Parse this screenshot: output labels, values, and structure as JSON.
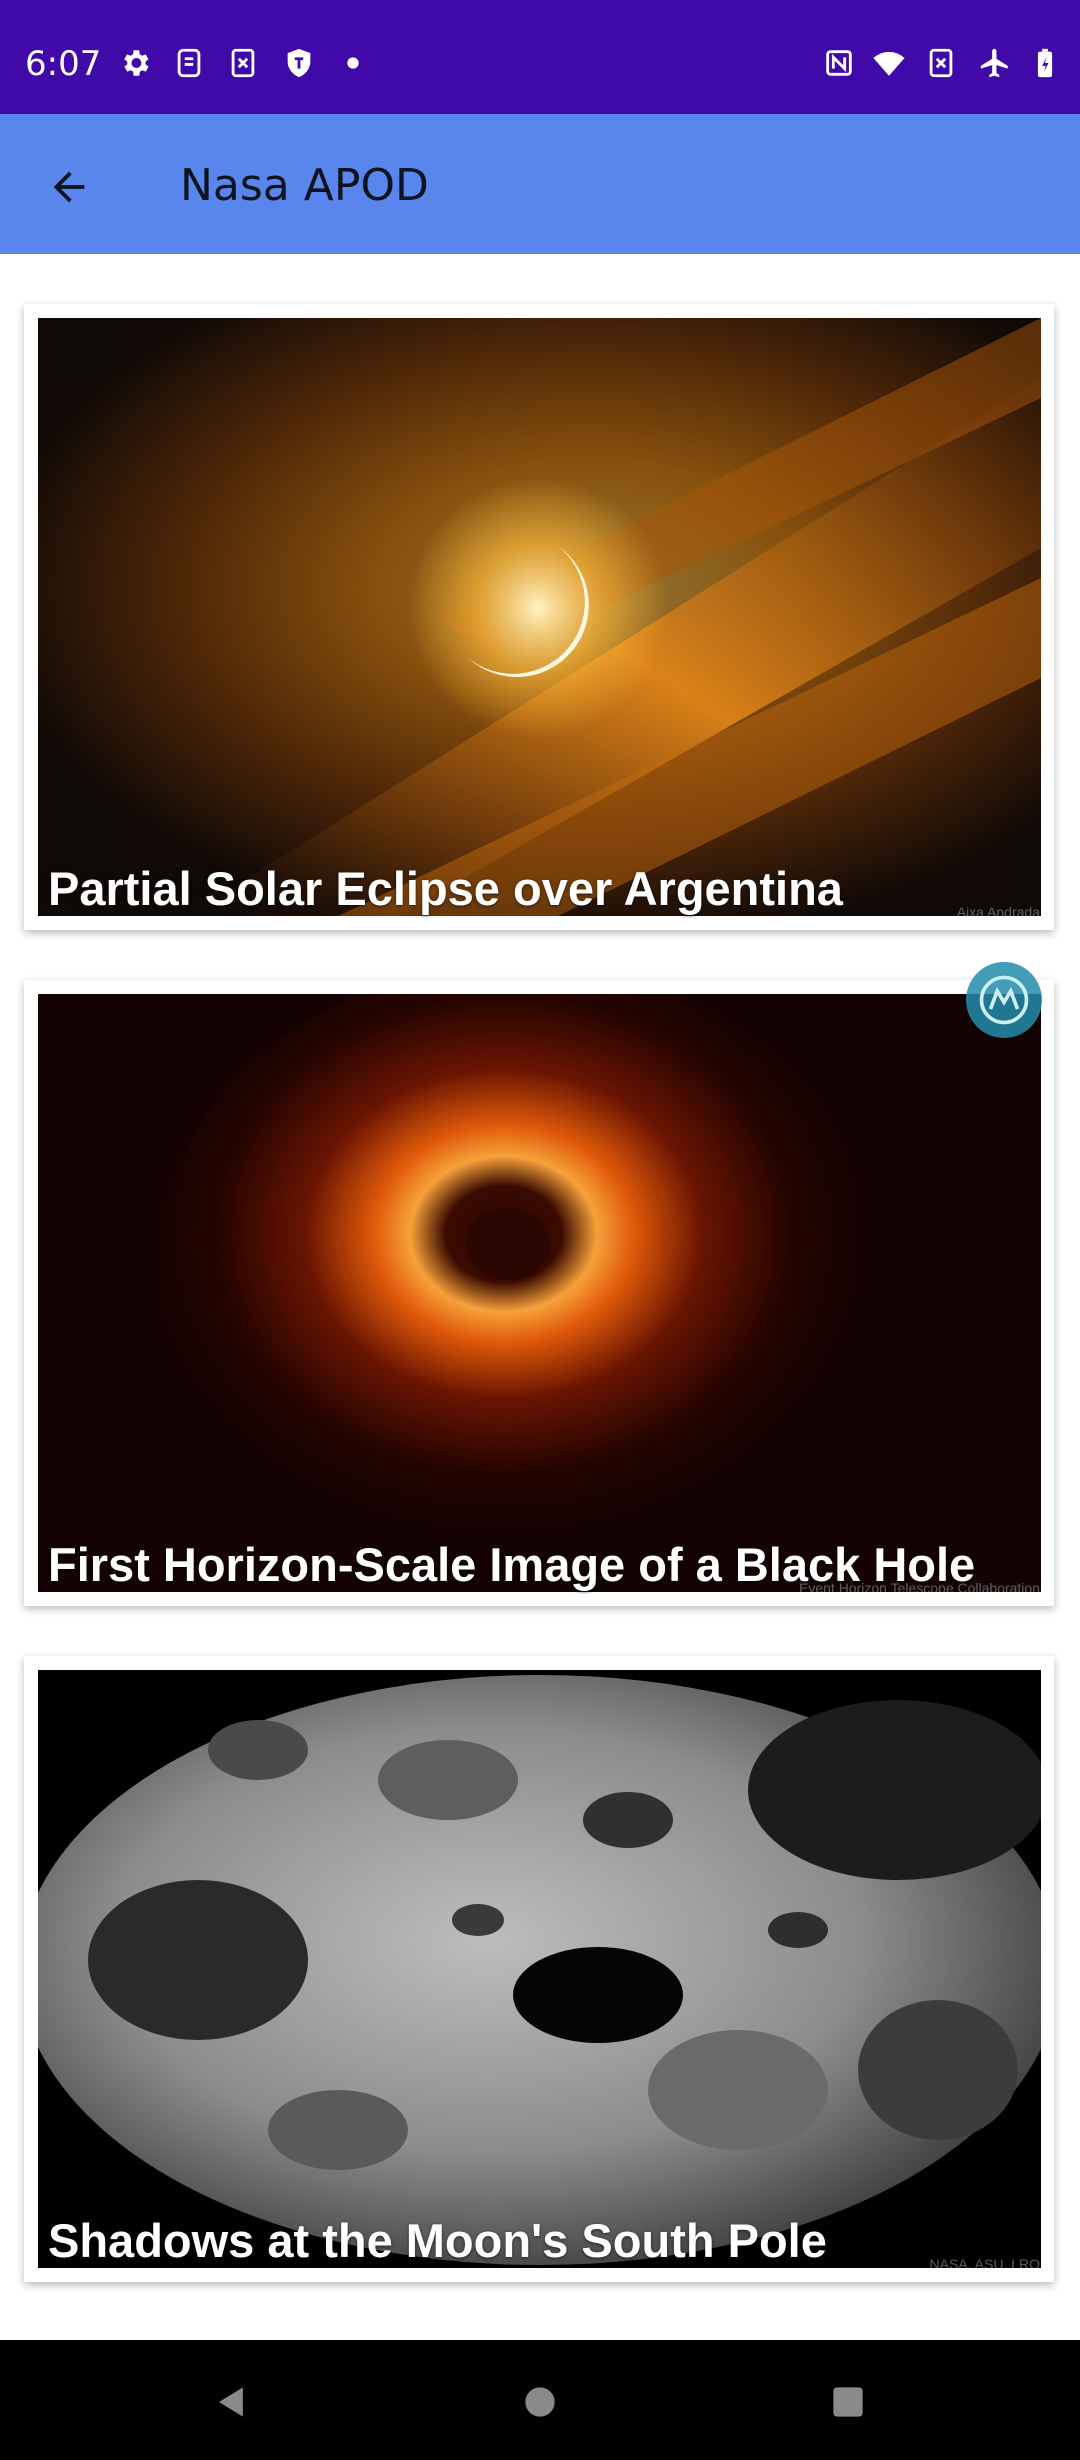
{
  "status_bar": {
    "time": "6:07",
    "left_icons": [
      "gear-icon",
      "sim-icon",
      "no-sim-icon",
      "shield-icon",
      "dot-icon"
    ],
    "right_icons": [
      "nfc-icon",
      "wifi-icon",
      "no-sim-icon",
      "airplane-icon",
      "battery-icon"
    ]
  },
  "app_bar": {
    "title": "Nasa APOD",
    "back_icon": "arrow-left-icon",
    "color": "#5886ec"
  },
  "cards": [
    {
      "caption": "Partial Solar Eclipse over Argentina",
      "credit": "Aixa Andrada"
    },
    {
      "caption": "First Horizon-Scale Image of a Black Hole",
      "credit": "Event Horizon Telescope Collaboration"
    },
    {
      "caption": "Shadows at the Moon's South Pole",
      "credit": "NASA, ASU, LRO"
    }
  ],
  "nav_bar": {
    "back": "triangle-back-icon",
    "home": "circle-home-icon",
    "recents": "square-recents-icon"
  },
  "colors": {
    "status_bar": "#3f0aa8",
    "app_bar": "#5886ec"
  }
}
